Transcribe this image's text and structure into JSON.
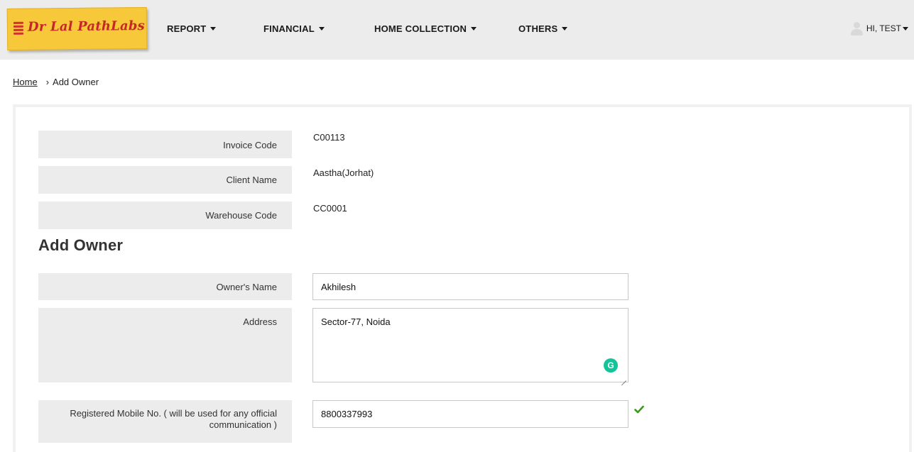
{
  "brand": {
    "name": "Dr Lal PathLabs",
    "accent": "#f7c83a",
    "text_color": "#c62828"
  },
  "nav": {
    "items": [
      {
        "label": "REPORT"
      },
      {
        "label": "FINANCIAL"
      },
      {
        "label": "HOME COLLECTION"
      },
      {
        "label": "OTHERS"
      }
    ],
    "user_label": "HI, TEST"
  },
  "breadcrumb": {
    "home": "Home",
    "current": "Add Owner"
  },
  "info": {
    "invoice_code": {
      "label": "Invoice Code",
      "value": "C00113"
    },
    "client_name": {
      "label": "Client Name",
      "value": "Aastha(Jorhat)"
    },
    "warehouse_code": {
      "label": "Warehouse Code",
      "value": "CC0001"
    }
  },
  "form": {
    "title": "Add Owner",
    "owner_name": {
      "label": "Owner's Name",
      "value": "Akhilesh"
    },
    "address": {
      "label": "Address",
      "value": "Sector-77, Noida"
    },
    "mobile": {
      "label": "Registered Mobile No. ( will be used for any official communication )",
      "value": "8800337993",
      "valid": true
    }
  },
  "icons": {
    "grammarly": "G",
    "breadcrumb_sep": "›",
    "valid_check_color": "#3a9a1c"
  }
}
